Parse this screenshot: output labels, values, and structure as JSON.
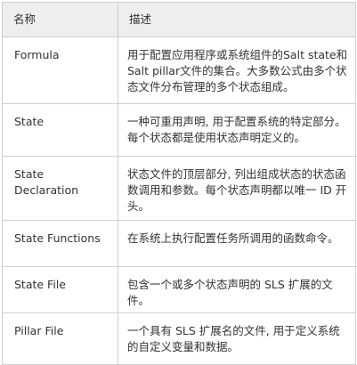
{
  "table": {
    "headers": [
      "名称",
      "描述"
    ],
    "rows": [
      {
        "name": "Formula",
        "description": "用于配置应用程序或系统组件的Salt state和Salt pillar文件的集合。大多数公式由多个状态文件分布管理的多个状态组成。"
      },
      {
        "name": "State",
        "description": "一种可重用声明, 用于配置系统的特定部分。每个状态都是使用状态声明定义的。"
      },
      {
        "name": "State Declaration",
        "description": "状态文件的顶层部分, 列出组成状态的状态函数调用和参数。每个状态声明都以唯一 ID 开头。"
      },
      {
        "name": "State Functions",
        "description": "在系统上执行配置任务所调用的函数命令。"
      },
      {
        "name": "State File",
        "description": "包含一个或多个状态声明的 SLS 扩展的文件。"
      },
      {
        "name": "Pillar File",
        "description": "一个具有 SLS 扩展名的文件, 用于定义系统的自定义变量和数据。"
      }
    ]
  }
}
